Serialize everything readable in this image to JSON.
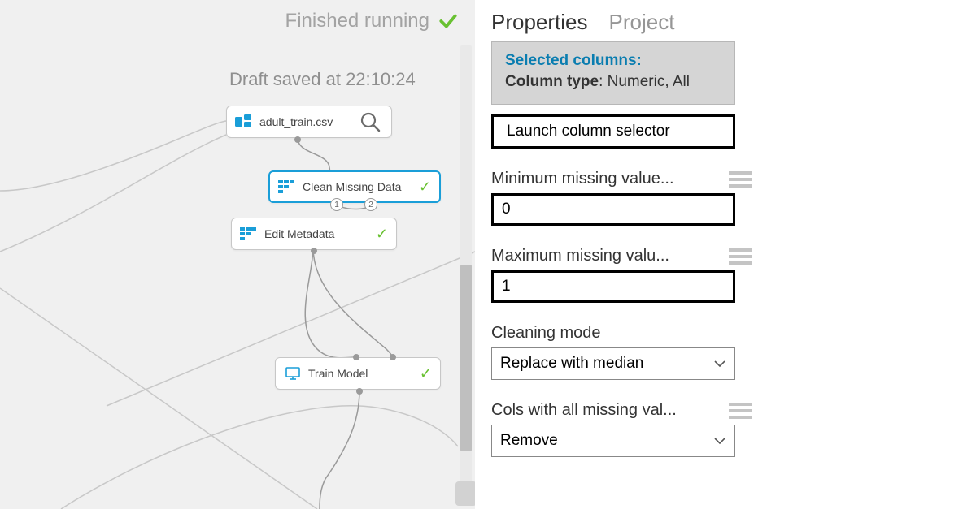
{
  "status": {
    "text": "Finished running"
  },
  "draft": {
    "text": "Draft saved at 22:10:24"
  },
  "nodes": {
    "n1": {
      "label": "adult_train.csv"
    },
    "n2": {
      "label": "Clean Missing Data",
      "port1": "1",
      "port2": "2"
    },
    "n3": {
      "label": "Edit Metadata"
    },
    "n4": {
      "label": "Train Model"
    }
  },
  "tabs": {
    "properties": "Properties",
    "project": "Project"
  },
  "props": {
    "selected_title": "Selected columns:",
    "column_type_key": "Column type",
    "column_type_val": ": Numeric, All",
    "launch_btn": "Launch column selector",
    "min_label": "Minimum missing value...",
    "min_value": "0",
    "max_label": "Maximum missing valu...",
    "max_value": "1",
    "cleaning_label": "Cleaning mode",
    "cleaning_value": "Replace with median",
    "cols_label": "Cols with all missing val...",
    "cols_value": "Remove"
  }
}
